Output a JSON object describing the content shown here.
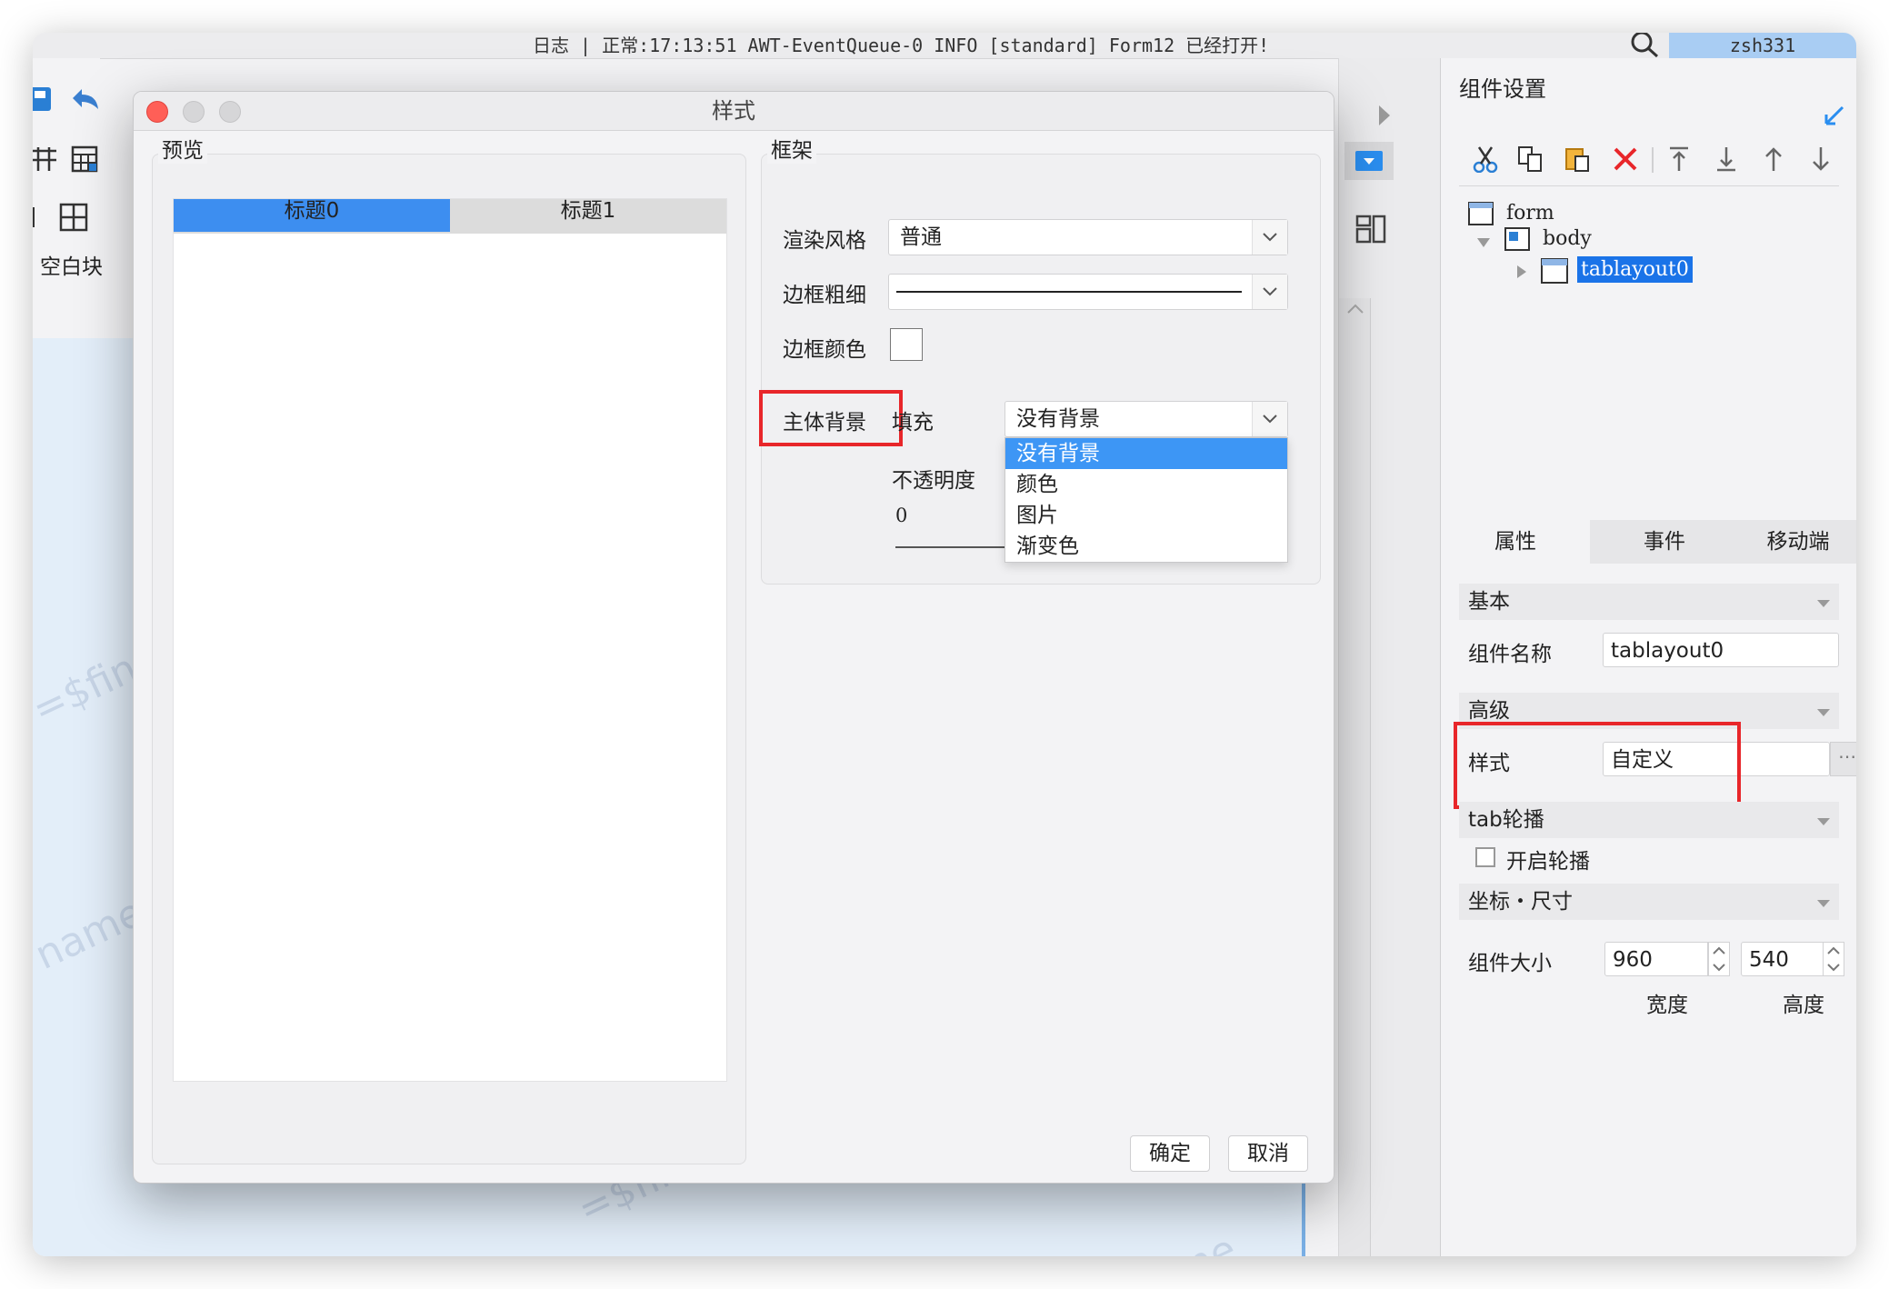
{
  "log": {
    "text": "日志 | 正常:17:13:51 AWT-EventQueue-0 INFO [standard] Form12 已经打开!",
    "user": "zsh331"
  },
  "left_strip": {
    "blank_label": "空白块"
  },
  "watermarks": [
    "=$fine_user",
    "name",
    "=$fine_user",
    "ername"
  ],
  "dialog": {
    "title": "样式",
    "preview": {
      "legend": "预览",
      "tabs": [
        "标题0",
        "标题1"
      ]
    },
    "frame": {
      "legend": "框架",
      "render_style_label": "渲染风格",
      "render_style_value": "普通",
      "border_width_label": "边框粗细",
      "border_color_label": "边框颜色",
      "body_bg_label": "主体背景",
      "fill_label": "填充",
      "fill_value": "没有背景",
      "opacity_label": "不透明度",
      "opacity_value": "0",
      "fill_options": [
        "没有背景",
        "颜色",
        "图片",
        "渐变色"
      ]
    },
    "ok_label": "确定",
    "cancel_label": "取消"
  },
  "right_panel": {
    "title": "组件设置",
    "tree": [
      "form",
      "body",
      "tablayout0"
    ],
    "tabs": [
      "属性",
      "事件",
      "移动端"
    ],
    "sections": {
      "basic": "基本",
      "advanced": "高级",
      "tab_carousel": "tab轮播",
      "coords": "坐标・尺寸"
    },
    "component_name_label": "组件名称",
    "component_name_value": "tablayout0",
    "style_label": "样式",
    "style_value": "自定义",
    "carousel_checkbox_label": "开启轮播",
    "size_label": "组件大小",
    "width_value": "960",
    "height_value": "540",
    "width_label": "宽度",
    "height_label": "高度"
  },
  "colors": {
    "accent": "#3d96f5",
    "highlight_red": "#e8262a",
    "selection_blue": "#1a73e8",
    "close_red": "#ff5f57"
  }
}
